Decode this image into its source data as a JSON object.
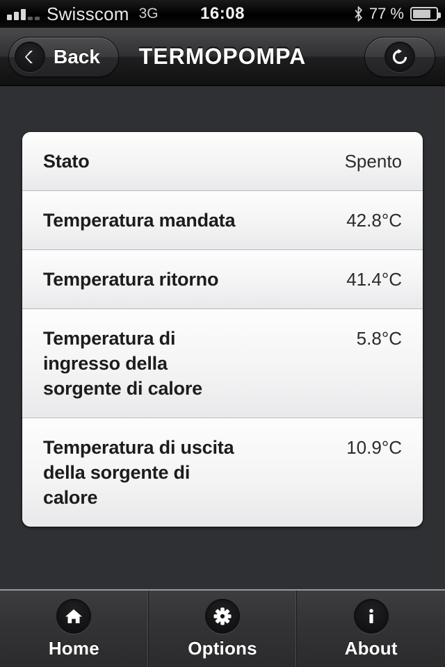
{
  "status_bar": {
    "carrier": "Swisscom",
    "network": "3G",
    "time": "16:08",
    "battery_percent": "77 %",
    "battery_level": 77,
    "bluetooth_icon": "bluetooth-icon",
    "signal_icon": "signal-bars-icon",
    "battery_icon": "battery-icon"
  },
  "navbar": {
    "back_label": "Back",
    "title": "TERMOPOMPA",
    "back_icon": "chevron-left-icon",
    "refresh_icon": "refresh-icon"
  },
  "list": {
    "rows": [
      {
        "label": "Stato",
        "value": "Spento"
      },
      {
        "label": "Temperatura mandata",
        "value": "42.8°C"
      },
      {
        "label": "Temperatura ritorno",
        "value": "41.4°C"
      },
      {
        "label": "Temperatura di ingresso della sorgente di calore",
        "value": "5.8°C"
      },
      {
        "label": "Temperatura di uscita della sorgente di calore",
        "value": "10.9°C"
      }
    ]
  },
  "tabbar": {
    "tabs": [
      {
        "label": "Home",
        "icon": "home-icon"
      },
      {
        "label": "Options",
        "icon": "gear-icon"
      },
      {
        "label": "About",
        "icon": "info-icon"
      }
    ]
  },
  "colors": {
    "background": "#2e3033",
    "card_background": "#f3f3f3",
    "navbar": "#313133",
    "tabbar": "#343436",
    "label_text": "#1c1c1c",
    "value_text": "#2b2b2b"
  }
}
